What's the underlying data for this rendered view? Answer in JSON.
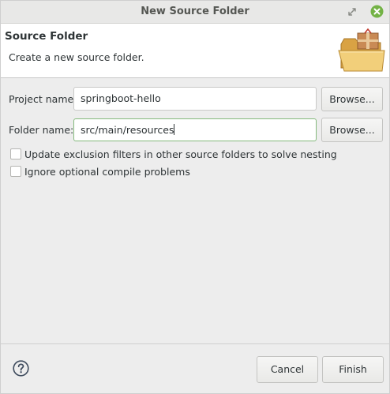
{
  "window": {
    "title": "New Source Folder"
  },
  "header": {
    "title": "Source Folder",
    "description": "Create a new source folder.",
    "icon": "folder-with-package-icon"
  },
  "form": {
    "project": {
      "label": "Project name:",
      "value": "springboot-hello",
      "browse_label": "Browse..."
    },
    "folder": {
      "label": "Folder name:",
      "value": "src/main/resources",
      "browse_label": "Browse..."
    },
    "options": [
      {
        "label": "Update exclusion filters in other source folders to solve nesting",
        "checked": false
      },
      {
        "label": "Ignore optional compile problems",
        "checked": false
      }
    ]
  },
  "footer": {
    "help_icon": "help-icon",
    "cancel_label": "Cancel",
    "finish_label": "Finish"
  },
  "colors": {
    "close_button": "#73b245",
    "focus_border": "#84b97c",
    "folder": "#e8b85c"
  }
}
